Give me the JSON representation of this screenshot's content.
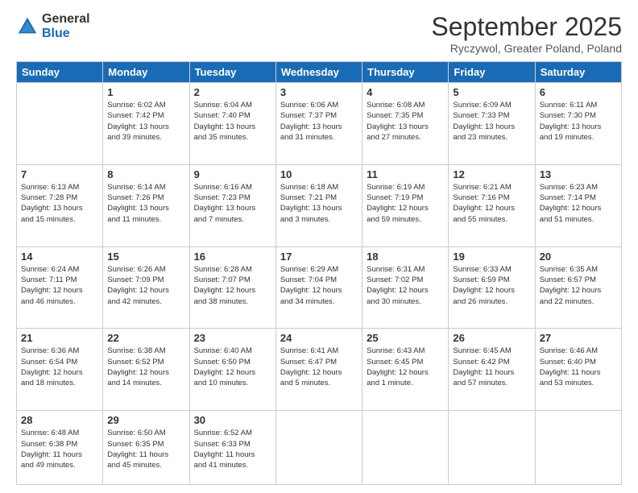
{
  "logo": {
    "general": "General",
    "blue": "Blue"
  },
  "title": "September 2025",
  "location": "Ryczywol, Greater Poland, Poland",
  "weekdays": [
    "Sunday",
    "Monday",
    "Tuesday",
    "Wednesday",
    "Thursday",
    "Friday",
    "Saturday"
  ],
  "weeks": [
    [
      {
        "day": "",
        "info": ""
      },
      {
        "day": "1",
        "info": "Sunrise: 6:02 AM\nSunset: 7:42 PM\nDaylight: 13 hours\nand 39 minutes."
      },
      {
        "day": "2",
        "info": "Sunrise: 6:04 AM\nSunset: 7:40 PM\nDaylight: 13 hours\nand 35 minutes."
      },
      {
        "day": "3",
        "info": "Sunrise: 6:06 AM\nSunset: 7:37 PM\nDaylight: 13 hours\nand 31 minutes."
      },
      {
        "day": "4",
        "info": "Sunrise: 6:08 AM\nSunset: 7:35 PM\nDaylight: 13 hours\nand 27 minutes."
      },
      {
        "day": "5",
        "info": "Sunrise: 6:09 AM\nSunset: 7:33 PM\nDaylight: 13 hours\nand 23 minutes."
      },
      {
        "day": "6",
        "info": "Sunrise: 6:11 AM\nSunset: 7:30 PM\nDaylight: 13 hours\nand 19 minutes."
      }
    ],
    [
      {
        "day": "7",
        "info": "Sunrise: 6:13 AM\nSunset: 7:28 PM\nDaylight: 13 hours\nand 15 minutes."
      },
      {
        "day": "8",
        "info": "Sunrise: 6:14 AM\nSunset: 7:26 PM\nDaylight: 13 hours\nand 11 minutes."
      },
      {
        "day": "9",
        "info": "Sunrise: 6:16 AM\nSunset: 7:23 PM\nDaylight: 13 hours\nand 7 minutes."
      },
      {
        "day": "10",
        "info": "Sunrise: 6:18 AM\nSunset: 7:21 PM\nDaylight: 13 hours\nand 3 minutes."
      },
      {
        "day": "11",
        "info": "Sunrise: 6:19 AM\nSunset: 7:19 PM\nDaylight: 12 hours\nand 59 minutes."
      },
      {
        "day": "12",
        "info": "Sunrise: 6:21 AM\nSunset: 7:16 PM\nDaylight: 12 hours\nand 55 minutes."
      },
      {
        "day": "13",
        "info": "Sunrise: 6:23 AM\nSunset: 7:14 PM\nDaylight: 12 hours\nand 51 minutes."
      }
    ],
    [
      {
        "day": "14",
        "info": "Sunrise: 6:24 AM\nSunset: 7:11 PM\nDaylight: 12 hours\nand 46 minutes."
      },
      {
        "day": "15",
        "info": "Sunrise: 6:26 AM\nSunset: 7:09 PM\nDaylight: 12 hours\nand 42 minutes."
      },
      {
        "day": "16",
        "info": "Sunrise: 6:28 AM\nSunset: 7:07 PM\nDaylight: 12 hours\nand 38 minutes."
      },
      {
        "day": "17",
        "info": "Sunrise: 6:29 AM\nSunset: 7:04 PM\nDaylight: 12 hours\nand 34 minutes."
      },
      {
        "day": "18",
        "info": "Sunrise: 6:31 AM\nSunset: 7:02 PM\nDaylight: 12 hours\nand 30 minutes."
      },
      {
        "day": "19",
        "info": "Sunrise: 6:33 AM\nSunset: 6:59 PM\nDaylight: 12 hours\nand 26 minutes."
      },
      {
        "day": "20",
        "info": "Sunrise: 6:35 AM\nSunset: 6:57 PM\nDaylight: 12 hours\nand 22 minutes."
      }
    ],
    [
      {
        "day": "21",
        "info": "Sunrise: 6:36 AM\nSunset: 6:54 PM\nDaylight: 12 hours\nand 18 minutes."
      },
      {
        "day": "22",
        "info": "Sunrise: 6:38 AM\nSunset: 6:52 PM\nDaylight: 12 hours\nand 14 minutes."
      },
      {
        "day": "23",
        "info": "Sunrise: 6:40 AM\nSunset: 6:50 PM\nDaylight: 12 hours\nand 10 minutes."
      },
      {
        "day": "24",
        "info": "Sunrise: 6:41 AM\nSunset: 6:47 PM\nDaylight: 12 hours\nand 5 minutes."
      },
      {
        "day": "25",
        "info": "Sunrise: 6:43 AM\nSunset: 6:45 PM\nDaylight: 12 hours\nand 1 minute."
      },
      {
        "day": "26",
        "info": "Sunrise: 6:45 AM\nSunset: 6:42 PM\nDaylight: 11 hours\nand 57 minutes."
      },
      {
        "day": "27",
        "info": "Sunrise: 6:46 AM\nSunset: 6:40 PM\nDaylight: 11 hours\nand 53 minutes."
      }
    ],
    [
      {
        "day": "28",
        "info": "Sunrise: 6:48 AM\nSunset: 6:38 PM\nDaylight: 11 hours\nand 49 minutes."
      },
      {
        "day": "29",
        "info": "Sunrise: 6:50 AM\nSunset: 6:35 PM\nDaylight: 11 hours\nand 45 minutes."
      },
      {
        "day": "30",
        "info": "Sunrise: 6:52 AM\nSunset: 6:33 PM\nDaylight: 11 hours\nand 41 minutes."
      },
      {
        "day": "",
        "info": ""
      },
      {
        "day": "",
        "info": ""
      },
      {
        "day": "",
        "info": ""
      },
      {
        "day": "",
        "info": ""
      }
    ]
  ]
}
